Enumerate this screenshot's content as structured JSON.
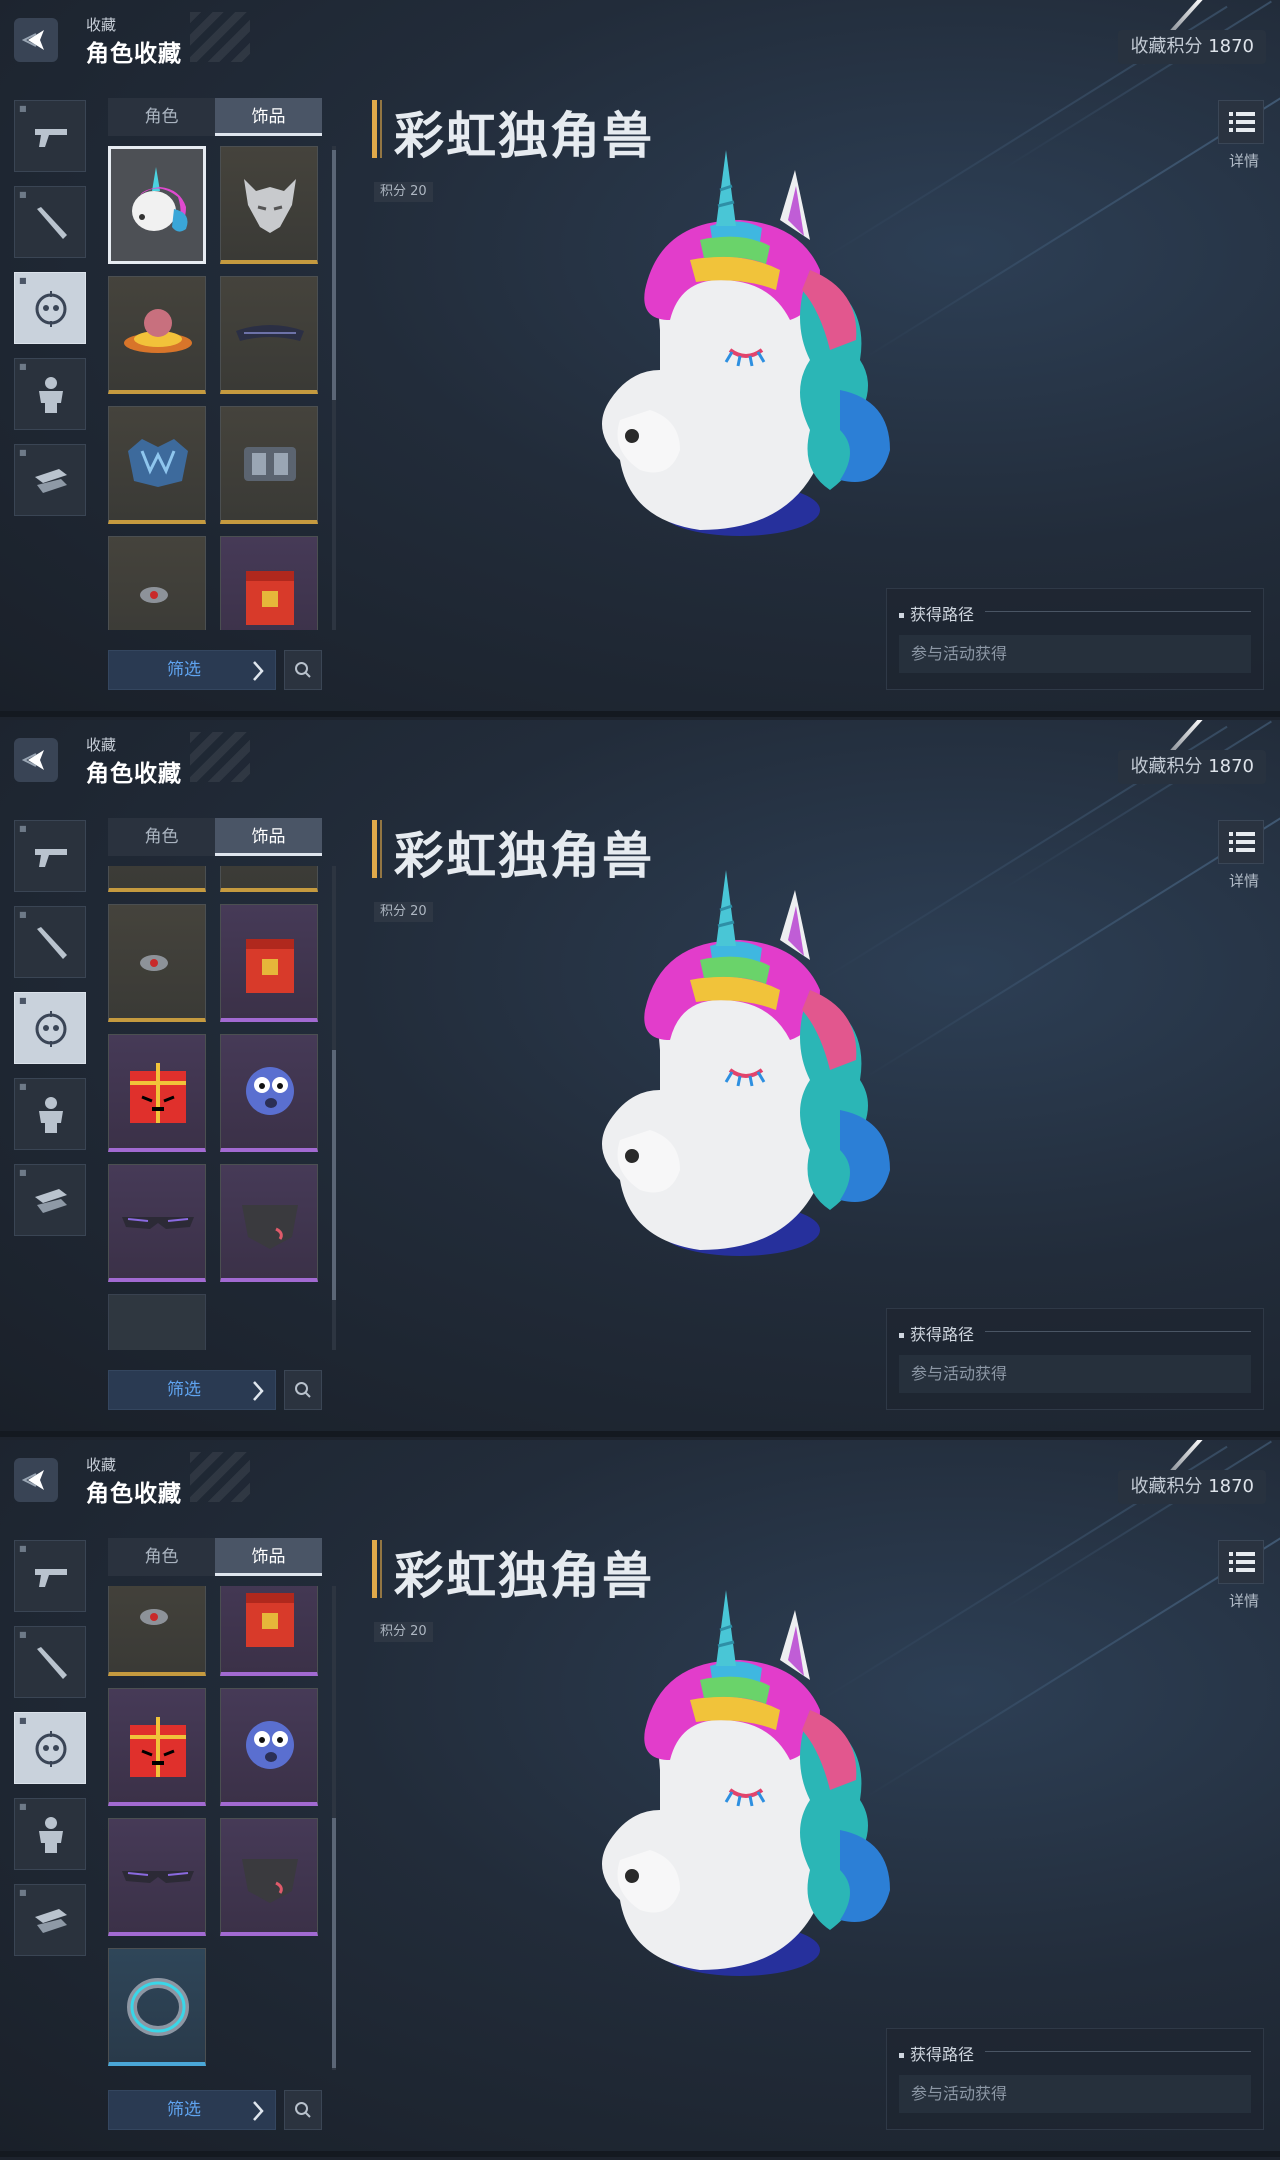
{
  "header": {
    "section": "收藏",
    "title": "角色收藏"
  },
  "score": {
    "label": "收藏积分",
    "value": "1870"
  },
  "tabs": [
    "角色",
    "饰品"
  ],
  "item": {
    "name": "彩虹独角兽",
    "points": "积分 20"
  },
  "detail_label": "详情",
  "acquire": {
    "heading": "获得路径",
    "method": "参与活动获得"
  },
  "filter_label": "筛选",
  "categories": [
    "pistol-icon",
    "melee-icon",
    "head-accessory-icon",
    "character-icon",
    "misc-icon"
  ],
  "colors": {
    "accent": "#e0a94a",
    "gold_rarity": "#c59a3f",
    "purple_rarity": "#a26ad2",
    "blue_rarity": "#4aa7d8",
    "filter_text": "#5fa3ef"
  }
}
